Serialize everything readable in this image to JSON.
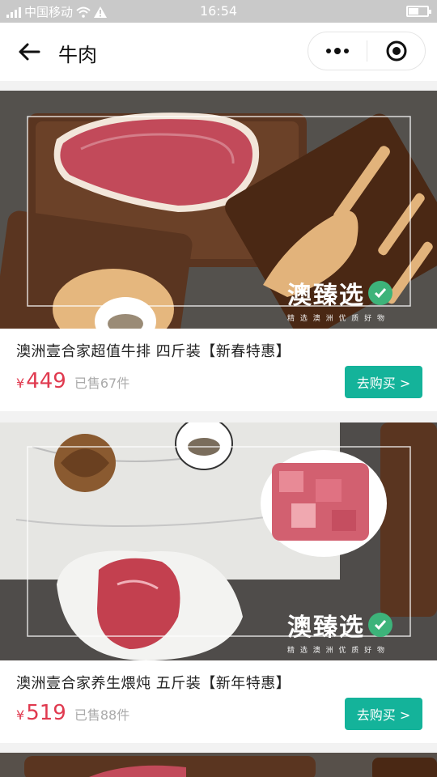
{
  "status": {
    "carrier": "中国移动",
    "time": "16:54"
  },
  "nav": {
    "title": "牛肉"
  },
  "watermark": {
    "brand": "澳臻选",
    "tagline": "精 选 澳 洲 优 质 好 物"
  },
  "products": [
    {
      "name": "澳洲壹合家超值牛排 四斤装【新春特惠】",
      "currency": "¥",
      "price": "449",
      "sold": "已售67件",
      "button": "去购买 >"
    },
    {
      "name": "澳洲壹合家养生煨炖 五斤装【新年特惠】",
      "currency": "¥",
      "price": "519",
      "sold": "已售88件",
      "button": "去购买 >"
    }
  ],
  "colors": {
    "accent": "#14b39a",
    "price": "#e03a4f",
    "status_bar": "#c9c9c9"
  }
}
